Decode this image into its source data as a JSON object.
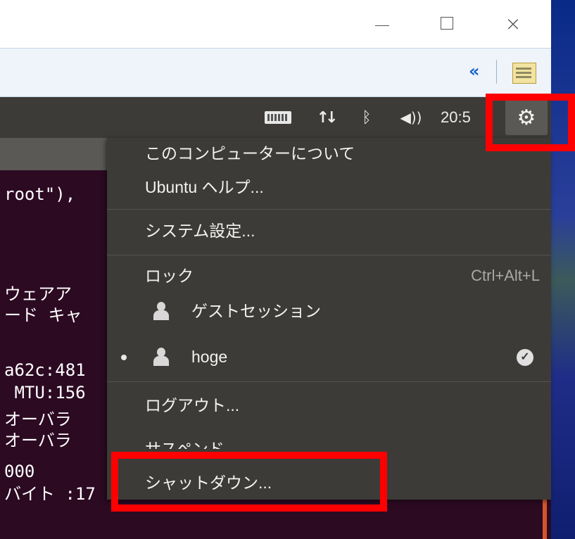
{
  "panel": {
    "clock": "20:5",
    "icons": [
      "keyboard-icon",
      "network-icon",
      "bluetooth-icon",
      "sound-icon",
      "power-gear-icon"
    ]
  },
  "terminal": {
    "lines": [
      "root\"),",
      "ウェアア",
      "ード キャ",
      "a62c:481",
      " MTU:156",
      "オーバラ",
      "オーバラ",
      "000",
      "バイト :17"
    ]
  },
  "menu": {
    "about": "このコンピューターについて",
    "help": "Ubuntu ヘルプ...",
    "settings": "システム設定...",
    "lock": "ロック",
    "lock_shortcut": "Ctrl+Alt+L",
    "guest": "ゲストセッション",
    "user": "hoge",
    "logout": "ログアウト...",
    "suspend": "サスペンド",
    "shutdown": "シャットダウン..."
  },
  "colors": {
    "panel": "#3d3b37",
    "menu": "#3c3b37",
    "terminal": "#2c0a22",
    "highlight": "#ff0000"
  }
}
